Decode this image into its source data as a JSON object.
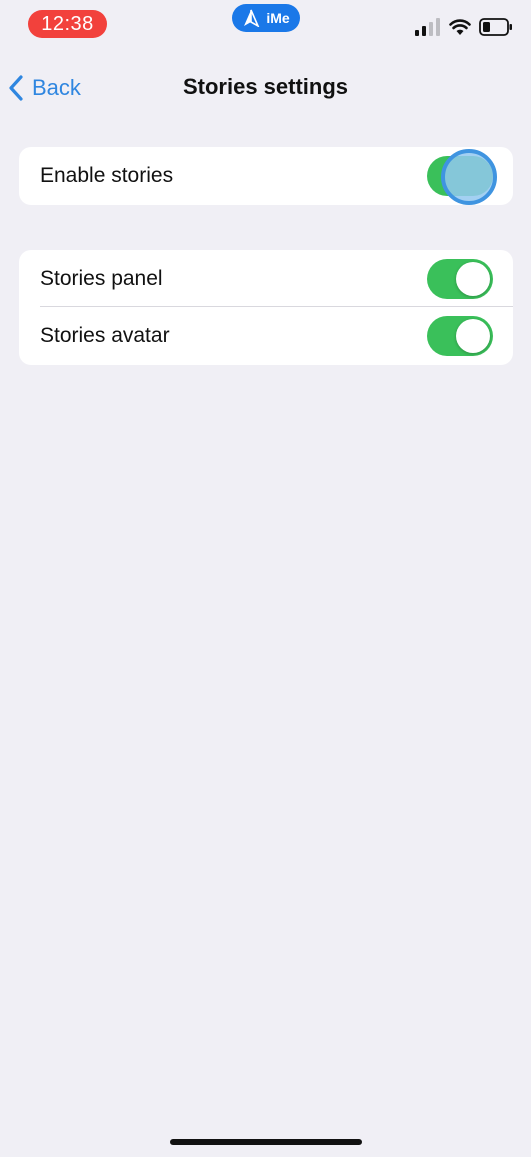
{
  "status_bar": {
    "time": "12:38",
    "app_badge": "iMe",
    "time_pill_color": "#f2413c",
    "app_pill_color": "#1a78e8",
    "icons": [
      "cellular-signal-icon",
      "wifi-icon",
      "battery-icon"
    ]
  },
  "nav": {
    "back_label": "Back",
    "title": "Stories settings",
    "accent_color": "#2f86e0"
  },
  "groups": [
    {
      "rows": [
        {
          "label": "Enable stories",
          "toggle_on": true
        }
      ]
    },
    {
      "rows": [
        {
          "label": "Stories panel",
          "toggle_on": true
        },
        {
          "label": "Stories avatar",
          "toggle_on": true
        }
      ]
    }
  ],
  "colors": {
    "toggle_on": "#3ac05a",
    "background": "#f0eff5",
    "touch_indicator": "#3f94e0"
  }
}
